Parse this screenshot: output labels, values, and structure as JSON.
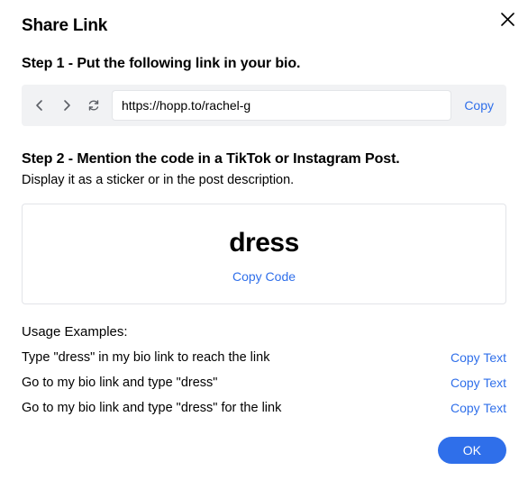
{
  "title": "Share Link",
  "step1": {
    "heading": "Step 1 - Put the following link in your bio.",
    "url": "https://hopp.to/rachel-g",
    "copy_label": "Copy"
  },
  "step2": {
    "heading": "Step 2 - Mention the code in a TikTok or Instagram Post.",
    "subtext": "Display it as a sticker or in the post description.",
    "code": "dress",
    "copy_code_label": "Copy Code"
  },
  "examples": {
    "heading": "Usage Examples:",
    "copy_label": "Copy Text",
    "items": [
      "Type \"dress\" in my bio link to reach the link",
      "Go to my bio link and type \"dress\"",
      "Go to my bio link and type \"dress\" for the link"
    ]
  },
  "footer": {
    "ok_label": "OK"
  }
}
